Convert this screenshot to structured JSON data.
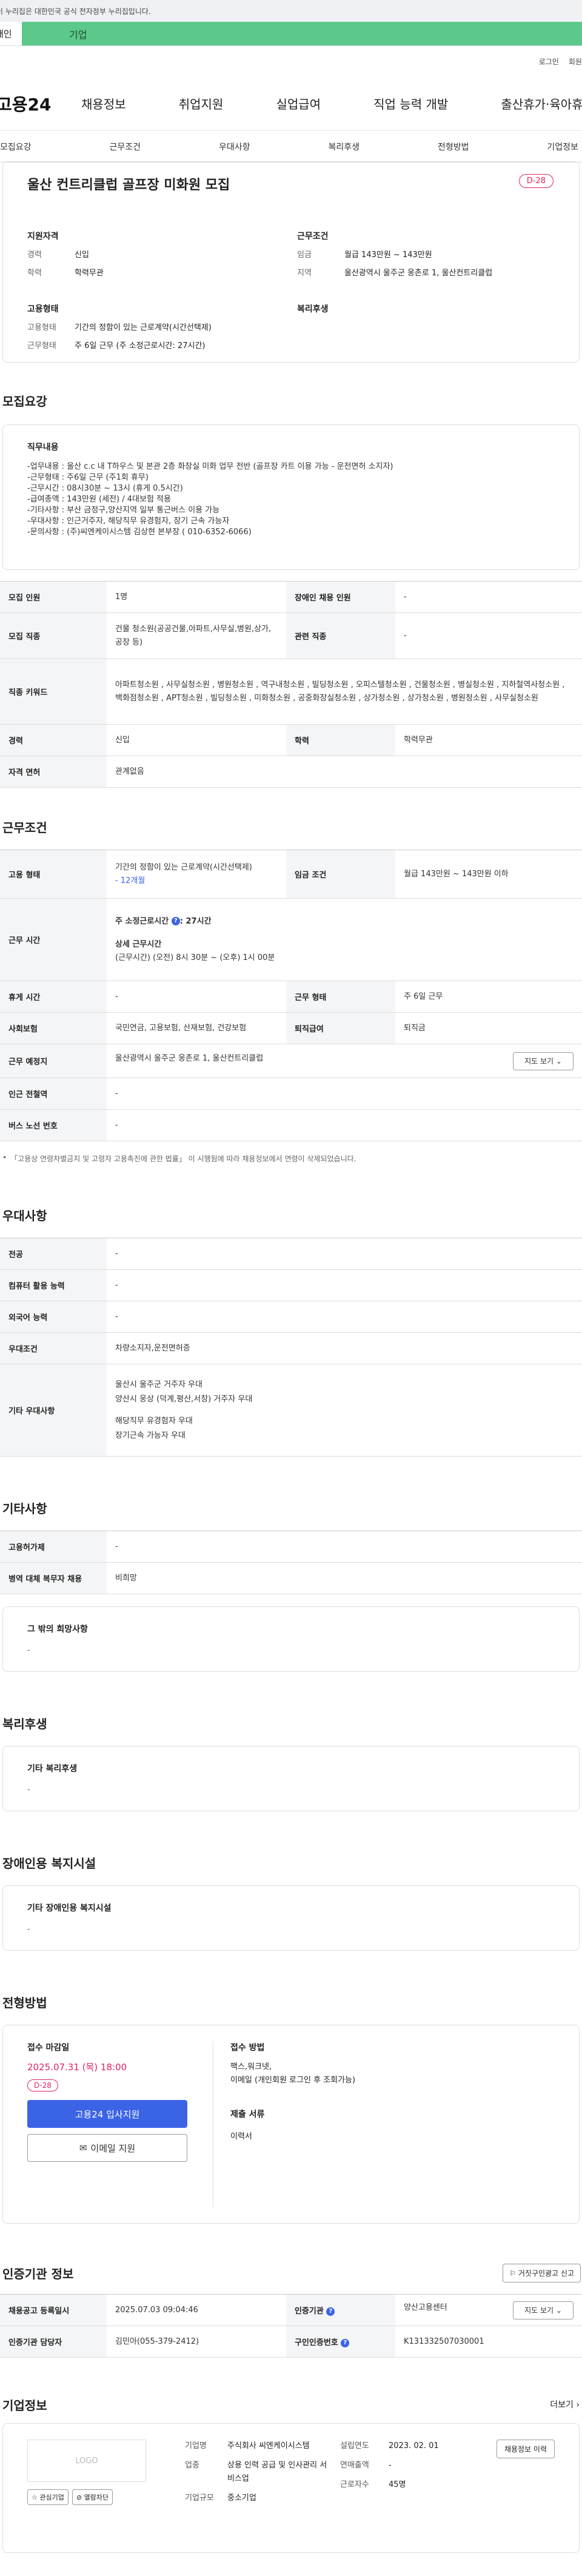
{
  "gov_banner": "이 누리집은 대한민국 공식 전자정부 누리집입니다.",
  "top_tabs": {
    "individual": "개인",
    "business": "기업"
  },
  "util": {
    "login": "로그인",
    "join": "회원가입"
  },
  "logo": "고용24",
  "gnb": [
    "채용정보",
    "취업지원",
    "실업급여",
    "직업 능력 개발",
    "출산휴가·육아휴직"
  ],
  "snb": [
    "모집요강",
    "근무조건",
    "우대사항",
    "복리후생",
    "전형방법",
    "기업정보"
  ],
  "title": "울산 컨트리클럽 골프장 미화원 모집",
  "dday": "D-28",
  "summary": {
    "qual_title": "지원자격",
    "qual": [
      {
        "k": "경력",
        "v": "신입"
      },
      {
        "k": "학력",
        "v": "학력무관"
      }
    ],
    "cond_title": "근무조건",
    "cond": [
      {
        "k": "임금",
        "v": "월급 143만원 ~ 143만원"
      },
      {
        "k": "지역",
        "v": "울산광역시 울주군 웅촌로 1, 울산컨트리클럽"
      }
    ],
    "emp_title": "고용형태",
    "emp": [
      {
        "k": "고용형태",
        "v": "기간의 정함이 있는 근로계약(시간선택제)"
      },
      {
        "k": "근무형태",
        "v": "주 6일 근무 (주 소정근로시간: 27시간)"
      }
    ],
    "welfare_title": "복리후생"
  },
  "recruit": {
    "section": "모집요강",
    "duty_title": "직무내용",
    "duty": "-업무내용 : 울산 c.c 내 T하우스 및 본관 2층 화장실 미화 업무 전반 (골프장 카트 이용 가능 - 운전면허 소지자)\n-근무형태 : 주6일 근무 (주1회 휴무)\n-근무시간 : 08시30분 ~ 13시 (휴게 0.5시간)\n-급여총액 : 143만원 (세전) / 4대보험 적용\n-기타사항 : 부산 금정구,양산지역 일부 통근버스 이용 가능\n-우대사항 : 인근거주자, 해당직무 유경험자, 장기 근속 가능자\n-문의사항 : (주)씨엔케이시스템 김상현 본부장 ( 010-6352-6066)",
    "rows": [
      {
        "k1": "모집 인원",
        "v1": "1명",
        "k2": "장애인 채용 인원",
        "v2": "-"
      },
      {
        "k1": "모집 직종",
        "v1": "건물 청소원(공공건물,아파트,사무실,병원,상가,공장 등)",
        "k2": "관련 직종",
        "v2": "-"
      },
      {
        "k1": "직종 키워드",
        "v1": "아파트청소원 , 사무실청소원 , 병원청소원 , 역구내청소원 , 빌딩청소원 , 오피스텔청소원 , 건물청소원 , 병실청소원 , 지하철역사청소원 , 백화점청소원 , APT청소원 , 빌딩청소원 , 미화청소원 , 공중화장실청소원 , 상가청소원 , 상가청소원 , 병원청소원 , 사무실청소원"
      },
      {
        "k1": "경력",
        "v1": "신입",
        "k2": "학력",
        "v2": "학력무관"
      },
      {
        "k1": "자격 면허",
        "v1": "관계없음"
      }
    ]
  },
  "conditions": {
    "section": "근무조건",
    "emp_type_k": "고용 형태",
    "emp_type_v": "기간의 정함이 있는 근로계약(시간선택제)",
    "emp_type_sub": "- 12개월",
    "wage_k": "임금 조건",
    "wage_v": "월급 143만원 ~ 143만원 이하",
    "time_k": "근무 시간",
    "time_total": "주 소정근로시간",
    "time_total_v": "27시간",
    "time_detail_title": "상세 근무시간",
    "time_detail": "(근무시간) (오전) 8시 30분 ~ (오후) 1시 00분",
    "rest_k": "휴게 시간",
    "rest_v": "-",
    "form_k": "근무 형태",
    "form_v": "주 6일 근무",
    "ins_k": "사회보험",
    "ins_v": "국민연금, 고용보험, 산재보험, 건강보험",
    "ret_k": "퇴직급여",
    "ret_v": "퇴직금",
    "place_k": "근무 예정지",
    "place_v": "울산광역시 울주군 웅촌로 1, 울산컨트리클럽",
    "map_btn": "지도 보기",
    "subway_k": "인근 전철역",
    "subway_v": "-",
    "bus_k": "버스 노선 번호",
    "bus_v": "-",
    "note": "「고용상 연령차별금지 및 고령자 고용촉진에 관한 법률」 이 시행됨에 따라 채용정보에서 연령이 삭제되었습니다."
  },
  "prefer": {
    "section": "우대사항",
    "rows": [
      {
        "k": "전공",
        "v": "-"
      },
      {
        "k": "컴퓨터 활용 능력",
        "v": "-"
      },
      {
        "k": "외국어 능력",
        "v": "-"
      },
      {
        "k": "우대조건",
        "v": "차량소지자,운전면허증"
      },
      {
        "k": "기타 우대사항",
        "v": [
          "울산시 울주군 거주자 우대",
          "양산시 웅상 (덕계,평산,서창) 거주자 우대",
          "",
          "해당직무 유경험자 우대",
          "장기근속 가능자 우대"
        ]
      }
    ]
  },
  "etc": {
    "section": "기타사항",
    "rows": [
      {
        "k": "고용허가제",
        "v": "-"
      },
      {
        "k": "병역 대체 복무자 채용",
        "v": "비희망"
      }
    ],
    "hope_title": "그 밖의 희망사항",
    "hope_v": "-"
  },
  "welfare": {
    "section": "복리후생",
    "title": "기타 복리후생",
    "v": "-"
  },
  "disabled": {
    "section": "장애인용 복지시설",
    "title": "기타 장애인용 복지시설",
    "v": "-"
  },
  "process": {
    "section": "전형방법",
    "deadline_title": "접수 마감일",
    "deadline": "2025.07.31 (목) 18:00",
    "dday": "D-28",
    "apply_btn": "고용24 입사지원",
    "email_btn": "이메일 지원",
    "method_title": "접수 방법",
    "method": "팩스,워크넷,\n이메일 (개인회원 로그인 후 조회가능)",
    "docs_title": "제출 서류",
    "docs": "이력서"
  },
  "agency": {
    "section": "인증기관 정보",
    "report_btn": "거짓구인광고 신고",
    "reg_k": "채용공고 등록일시",
    "reg_v": "2025.07.03 09:04:46",
    "inst_k": "인증기관",
    "inst_v": "양산고용센터",
    "map_btn": "지도 보기",
    "mgr_k": "인증기관 담당자",
    "mgr_v": "김민아(055-379-2412)",
    "num_k": "구인인증번호",
    "num_v": "K131332507030001"
  },
  "company": {
    "section": "기업정보",
    "more": "더보기",
    "logo": "LOGO",
    "fav": "관심기업",
    "block": "열람차단",
    "name_k": "기업명",
    "name_v": "주식회사 씨엔케이시스템",
    "ind_k": "업종",
    "ind_v": "상용 인력 공급 및 인사관리 서비스업",
    "size_k": "기업규모",
    "size_v": "중소기업",
    "est_k": "설립연도",
    "est_v": "2023. 02. 01",
    "sales_k": "연매출액",
    "sales_v": "-",
    "emp_k": "근로자수",
    "emp_v": "45명",
    "hist_btn": "채용정보 이력"
  }
}
